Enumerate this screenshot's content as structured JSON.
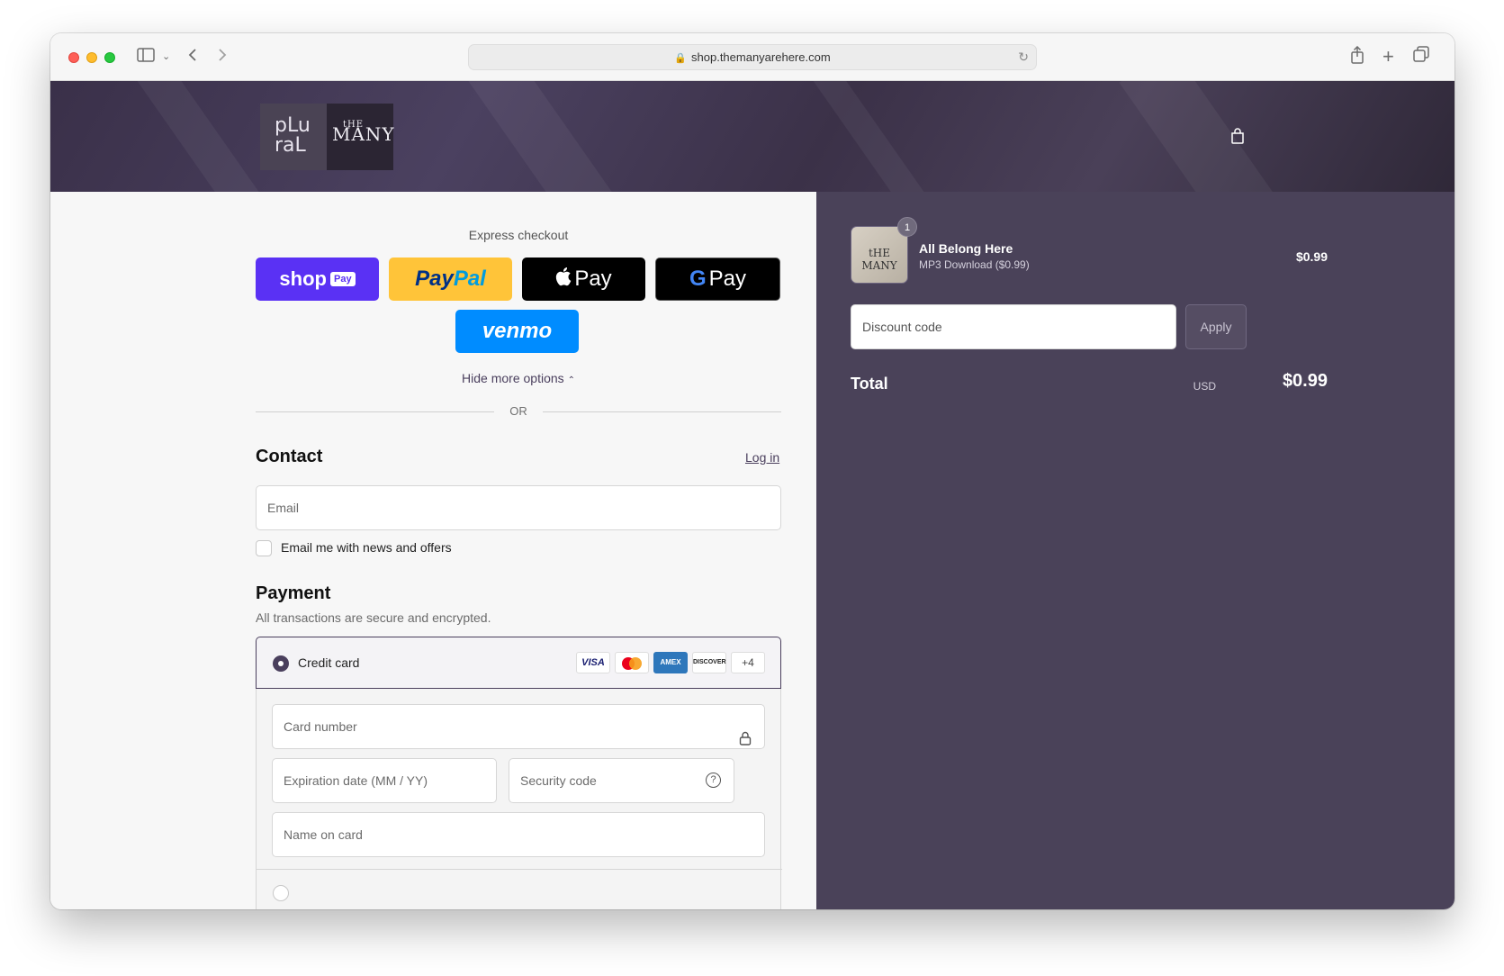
{
  "browser": {
    "url": "shop.themanyarehere.com"
  },
  "header": {
    "logo_left": "pLu raL",
    "logo_right_small": "tHE",
    "logo_right": "MANY"
  },
  "express": {
    "label": "Express checkout",
    "shoppay": "shop",
    "shoppay_tag": "Pay",
    "paypal_a": "Pay",
    "paypal_b": "Pal",
    "applepay": "Pay",
    "gpay": "Pay",
    "venmo": "venmo",
    "hide_more": "Hide more options",
    "or": "OR"
  },
  "contact": {
    "title": "Contact",
    "login": "Log in",
    "email_placeholder": "Email",
    "newsletter_label": "Email me with news and offers"
  },
  "payment": {
    "title": "Payment",
    "subtitle": "All transactions are secure and encrypted.",
    "method_label": "Credit card",
    "card_brands": [
      "VISA",
      "",
      "AMEX",
      "DISCOVER",
      "+4"
    ],
    "card_number": "Card number",
    "expiration": "Expiration date (MM / YY)",
    "security": "Security code",
    "name_on_card": "Name on card"
  },
  "summary": {
    "quantity": "1",
    "product_name": "All Belong Here",
    "product_variant": "MP3 Download ($0.99)",
    "product_price": "$0.99",
    "discount_placeholder": "Discount code",
    "apply": "Apply",
    "total_label": "Total",
    "currency": "USD",
    "total": "$0.99"
  },
  "colors": {
    "accent": "#4a3f5d",
    "summary_bg": "#4a4259",
    "shoppay": "#5a31f4",
    "paypal": "#ffc439",
    "venmo": "#008cff"
  }
}
